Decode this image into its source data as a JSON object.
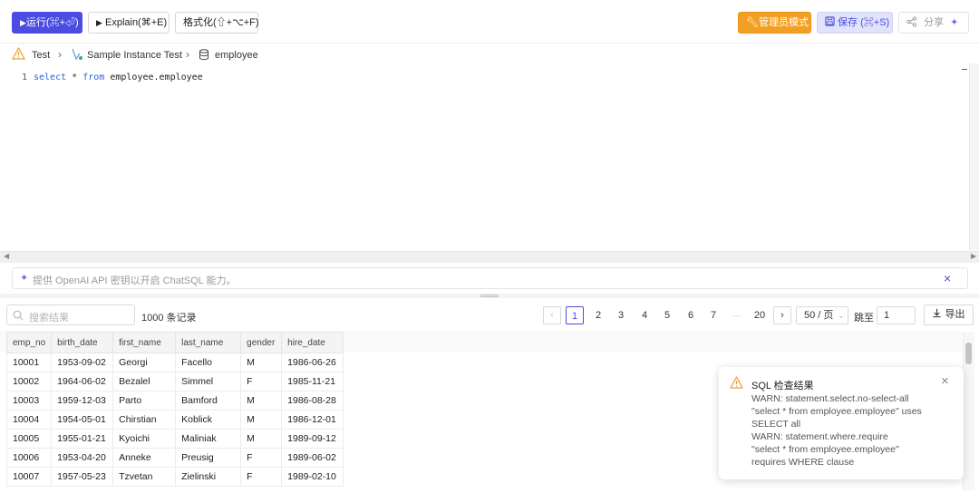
{
  "toolbar": {
    "run_label": "运行(⌘+⏎)",
    "explain_label": "Explain(⌘+E)",
    "format_label": "格式化(⇧+⌥+F)",
    "admin_label": "管理员模式",
    "save_label": "保存 (⌘+S)",
    "share_label": "分享"
  },
  "breadcrumb": {
    "environment": "Test",
    "instance": "Sample Instance Test",
    "database": "employee"
  },
  "editor": {
    "line_number": "1",
    "kw_select": "select",
    "star": "*",
    "kw_from": "from",
    "table_ref": "employee.employee"
  },
  "ai_bar": {
    "text": "提供 OpenAI API 密钥以开启 ChatSQL 能力。"
  },
  "results": {
    "search_placeholder": "搜索结果",
    "record_count": "1000 条记录",
    "pagination": {
      "pages": [
        "1",
        "2",
        "3",
        "4",
        "5",
        "6",
        "7"
      ],
      "ellipsis": "···",
      "last_page": "20",
      "current": "1",
      "page_size": "50 / 页",
      "jump_label": "跳至",
      "jump_value": "1"
    },
    "export_label": "导出",
    "columns": [
      "emp_no",
      "birth_date",
      "first_name",
      "last_name",
      "gender",
      "hire_date"
    ],
    "rows": [
      [
        "10001",
        "1953-09-02",
        "Georgi",
        "Facello",
        "M",
        "1986-06-26"
      ],
      [
        "10002",
        "1964-06-02",
        "Bezalel",
        "Simmel",
        "F",
        "1985-11-21"
      ],
      [
        "10003",
        "1959-12-03",
        "Parto",
        "Bamford",
        "M",
        "1986-08-28"
      ],
      [
        "10004",
        "1954-05-01",
        "Chirstian",
        "Koblick",
        "M",
        "1986-12-01"
      ],
      [
        "10005",
        "1955-01-21",
        "Kyoichi",
        "Maliniak",
        "M",
        "1989-09-12"
      ],
      [
        "10006",
        "1953-04-20",
        "Anneke",
        "Preusig",
        "F",
        "1989-06-02"
      ],
      [
        "10007",
        "1957-05-23",
        "Tzvetan",
        "Zielinski",
        "F",
        "1989-02-10"
      ]
    ]
  },
  "sql_check": {
    "title": "SQL 检查结果",
    "lines": [
      "WARN: statement.select.no-select-all",
      "\"select * from employee.employee\" uses",
      "SELECT all",
      "WARN: statement.where.require",
      "\"select * from employee.employee\"",
      "requires WHERE clause"
    ]
  },
  "colors": {
    "accent": "#4a4de0",
    "admin": "#f2a024",
    "warning": "#e8a33c"
  }
}
